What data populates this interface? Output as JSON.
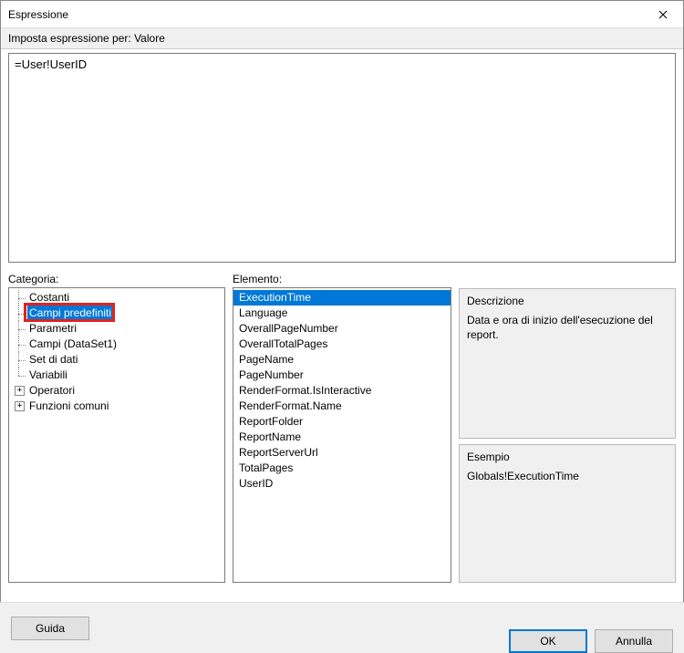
{
  "window": {
    "title": "Espressione"
  },
  "subtitle": "Imposta espressione per: Valore",
  "expression": "=User!UserID",
  "labels": {
    "category": "Categoria:",
    "element": "Elemento:",
    "description": "Descrizione",
    "example": "Esempio"
  },
  "category_tree": [
    {
      "label": "Costanti",
      "level": 1,
      "expandable": false,
      "selected": false
    },
    {
      "label": "Campi predefiniti",
      "level": 1,
      "expandable": false,
      "selected": true,
      "highlighted": true
    },
    {
      "label": "Parametri",
      "level": 1,
      "expandable": false,
      "selected": false
    },
    {
      "label": "Campi (DataSet1)",
      "level": 1,
      "expandable": false,
      "selected": false
    },
    {
      "label": "Set di dati",
      "level": 1,
      "expandable": false,
      "selected": false
    },
    {
      "label": "Variabili",
      "level": 1,
      "expandable": false,
      "selected": false,
      "last": true
    },
    {
      "label": "Operatori",
      "level": 0,
      "expandable": true,
      "selected": false
    },
    {
      "label": "Funzioni comuni",
      "level": 0,
      "expandable": true,
      "selected": false
    }
  ],
  "elements": [
    {
      "label": "ExecutionTime",
      "selected": true
    },
    {
      "label": "Language",
      "selected": false
    },
    {
      "label": "OverallPageNumber",
      "selected": false
    },
    {
      "label": "OverallTotalPages",
      "selected": false
    },
    {
      "label": "PageName",
      "selected": false
    },
    {
      "label": "PageNumber",
      "selected": false
    },
    {
      "label": "RenderFormat.IsInteractive",
      "selected": false
    },
    {
      "label": "RenderFormat.Name",
      "selected": false
    },
    {
      "label": "ReportFolder",
      "selected": false
    },
    {
      "label": "ReportName",
      "selected": false
    },
    {
      "label": "ReportServerUrl",
      "selected": false
    },
    {
      "label": "TotalPages",
      "selected": false
    },
    {
      "label": "UserID",
      "selected": false
    }
  ],
  "description_text": "Data e ora di inizio dell'esecuzione del report.",
  "example_text": "Globals!ExecutionTime",
  "buttons": {
    "help": "Guida",
    "ok": "OK",
    "cancel": "Annulla"
  }
}
